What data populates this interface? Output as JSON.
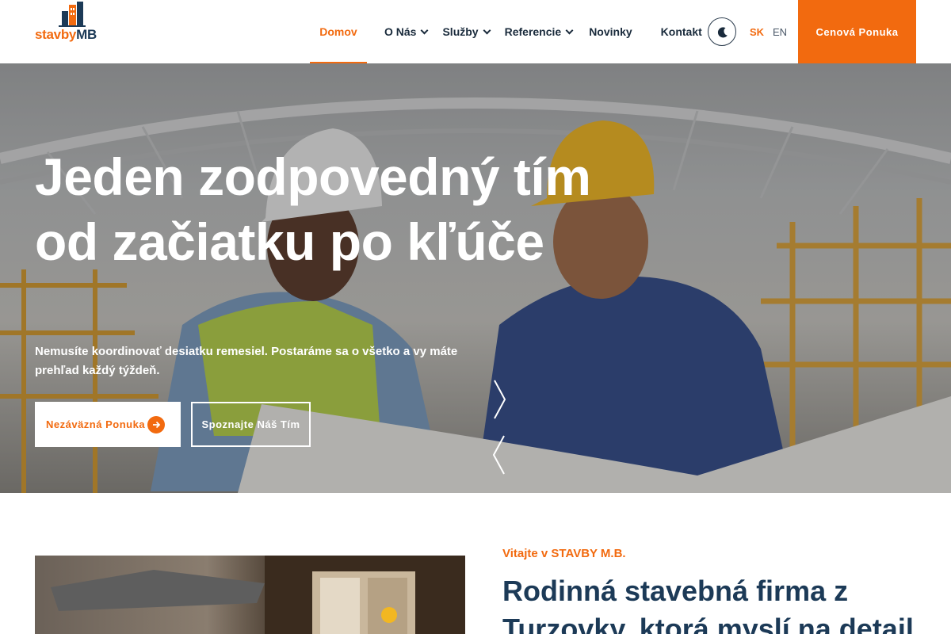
{
  "brand": {
    "logo_part1": "stavby",
    "logo_part2": "MB",
    "accent": "#f26a0f",
    "navy": "#1c3a57"
  },
  "nav": {
    "items": [
      {
        "label": "Domov",
        "active": true,
        "dropdown": false
      },
      {
        "label": "O Nás",
        "active": false,
        "dropdown": true
      },
      {
        "label": "Služby",
        "active": false,
        "dropdown": true
      },
      {
        "label": "Referencie",
        "active": false,
        "dropdown": true
      },
      {
        "label": "Novinky",
        "active": false,
        "dropdown": false
      },
      {
        "label": "Kontakt",
        "active": false,
        "dropdown": false
      }
    ],
    "theme_icon": "moon-icon",
    "lang_sk": "SK",
    "lang_en": "EN",
    "cta": "Cenová Ponuka"
  },
  "hero": {
    "title_line1": "Jeden zodpovedný tím",
    "title_line2": "od začiatku po kľúče",
    "subtitle": "Nemusíte koordinovať desiatku remesiel. Postaráme sa o všetko a vy máte prehľad každý týždeň.",
    "primary_button": "Nezáväzná Ponuka",
    "secondary_button": "Spoznajte Náš Tím"
  },
  "intro": {
    "kicker": "Vitajte v STAVBY M.B.",
    "title": "Rodinná stavebná firma z Turzovky, ktorá myslí na detail"
  }
}
